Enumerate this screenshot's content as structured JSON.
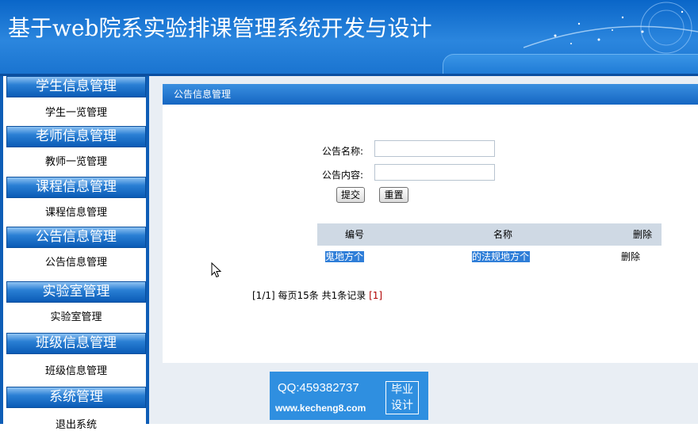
{
  "banner": {
    "title": "基于web院系实验排课管理系统开发与设计"
  },
  "sidebar": {
    "sections": [
      {
        "title": "学生信息管理",
        "item": "学生一览管理"
      },
      {
        "title": "老师信息管理",
        "item": "教师一览管理"
      },
      {
        "title": "课程信息管理",
        "item": "课程信息管理"
      },
      {
        "title": "公告信息管理",
        "item": "公告信息管理"
      },
      {
        "title": "实验室管理",
        "item": "实验室管理"
      },
      {
        "title": "班级信息管理",
        "item": "班级信息管理"
      },
      {
        "title": "系统管理",
        "item": "退出系统"
      }
    ]
  },
  "panel": {
    "title": "公告信息管理",
    "form": {
      "name_label": "公告名称:",
      "name_value": "",
      "content_label": "公告内容:",
      "content_value": "",
      "submit_label": "提交",
      "reset_label": "重置"
    },
    "table": {
      "headers": [
        "编号",
        "名称",
        "删除"
      ],
      "rows": [
        {
          "id": "鬼地方个",
          "name": "的法规地方个",
          "action": "删除"
        }
      ]
    },
    "pager": {
      "page_info": "[1/1]",
      "per_page": "每页15条",
      "total": "共1条记录",
      "current_link": "[1]"
    }
  },
  "watermark": {
    "qq": "QQ:459382737",
    "url": "www.kecheng8.com",
    "badge_line1": "毕业",
    "badge_line2": "设计"
  },
  "colors": {
    "banner": "#1a74d0",
    "menu_header": "#0a5bb6",
    "table_header": "#cfd9e4",
    "selection": "#2f7ed8"
  }
}
